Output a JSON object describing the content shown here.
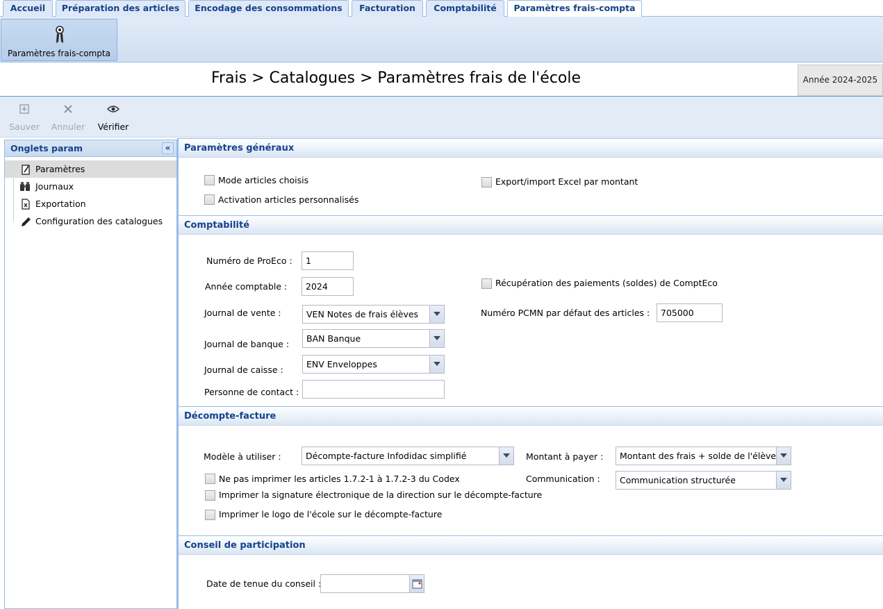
{
  "tabs": [
    "Accueil",
    "Préparation des articles",
    "Encodage des consommations",
    "Facturation",
    "Comptabilité",
    "Paramètres frais-compta"
  ],
  "ribbon": {
    "button_label": "Paramètres frais-compta"
  },
  "breadcrumb": "Frais > Catalogues > Paramètres frais de l'école",
  "year": "Année 2024-2025",
  "toolbar": {
    "save": "Sauver",
    "cancel": "Annuler",
    "verify": "Vérifier"
  },
  "left_panel": {
    "title": "Onglets param",
    "items": [
      "Paramètres",
      "Journaux",
      "Exportation",
      "Configuration des catalogues"
    ]
  },
  "general": {
    "title": "Paramètres généraux",
    "mode_articles": "Mode articles choisis",
    "activation": "Activation articles personnalisés",
    "export_excel": "Export/import Excel par montant"
  },
  "compta": {
    "title": "Comptabilité",
    "proeco_label": "Numéro de ProEco :",
    "proeco_value": "1",
    "annee_label": "Année comptable :",
    "annee_value": "2024",
    "vente_label": "Journal de vente :",
    "vente_value": "VEN Notes de frais élèves",
    "banque_label": "Journal de banque :",
    "banque_value": "BAN Banque",
    "caisse_label": "Journal de caisse :",
    "caisse_value": "ENV Enveloppes",
    "contact_label": "Personne de contact :",
    "contact_value": "",
    "recup_label": "Récupération des paiements (soldes) de ComptEco",
    "pcmn_label": "Numéro PCMN par défaut des articles :",
    "pcmn_value": "705000"
  },
  "decompte": {
    "title": "Décompte-facture",
    "modele_label": "Modèle à utiliser :",
    "modele_value": "Décompte-facture Infodidac simplifié",
    "montant_label": "Montant à payer :",
    "montant_value": "Montant des frais + solde de l'élève",
    "comm_label": "Communication :",
    "comm_value": "Communication structurée",
    "cb1": "Ne pas imprimer les articles 1.7.2-1 à 1.7.2-3 du Codex",
    "cb2": "Imprimer la signature électronique de la direction sur le décompte-facture",
    "cb3": "Imprimer le logo de l'école sur le décompte-facture"
  },
  "conseil": {
    "title": "Conseil de participation",
    "date_label": "Date de tenue du conseil :",
    "date_value": ""
  }
}
